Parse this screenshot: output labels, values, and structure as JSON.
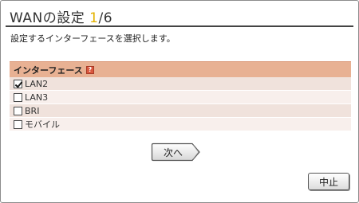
{
  "header": {
    "title": "WANの設定 ",
    "step": "1",
    "step_total": "/6"
  },
  "description": "設定するインターフェースを選択します。",
  "interface_table": {
    "header_label": "インターフェース",
    "help_icon_glyph": "?",
    "options": [
      {
        "label": "LAN2",
        "checked": true
      },
      {
        "label": "LAN3",
        "checked": false
      },
      {
        "label": "BRI",
        "checked": false
      },
      {
        "label": "モバイル",
        "checked": false
      }
    ]
  },
  "buttons": {
    "next_label": "次へ",
    "cancel_label": "中止"
  },
  "colors": {
    "step_accent": "#e3b200",
    "table_header": "#e8b193",
    "row_odd": "#f0e2dc",
    "row_even": "#f8efec"
  }
}
